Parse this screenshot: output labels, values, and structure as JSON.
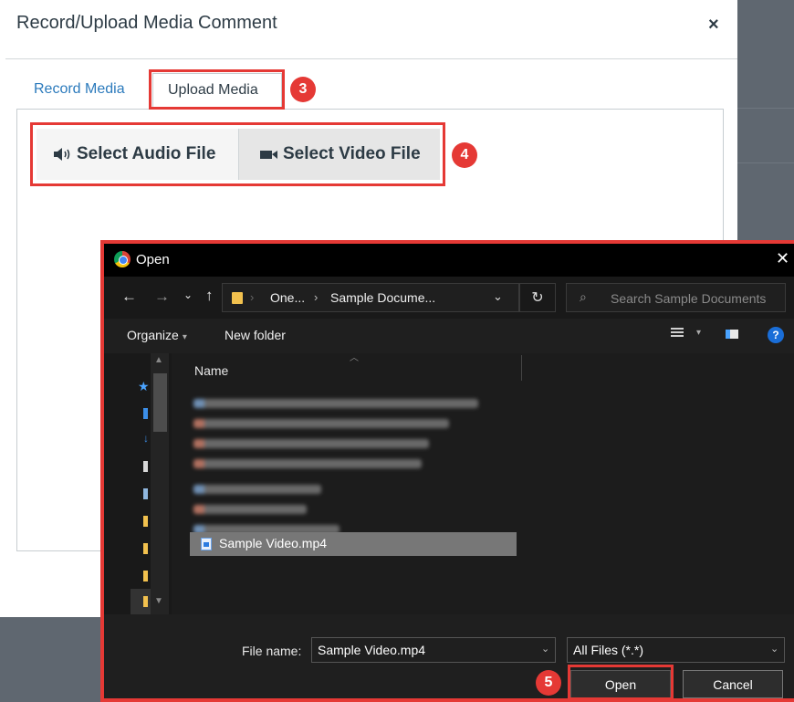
{
  "modal": {
    "title": "Record/Upload Media Comment",
    "close_glyph": "×",
    "tabs": [
      {
        "label": "Record Media",
        "active": false
      },
      {
        "label": "Upload Media",
        "active": true
      }
    ],
    "buttons": {
      "audio": {
        "label": "Select Audio File",
        "icon": "speaker-icon"
      },
      "video": {
        "label": "Select Video File",
        "icon": "video-camera-icon"
      }
    }
  },
  "annotations": {
    "step3": "3",
    "step4": "4",
    "step5": "5",
    "color": "#e53935"
  },
  "open_dialog": {
    "title": "Open",
    "close_glyph": "✕",
    "breadcrumb": [
      "One...",
      "Sample Docume..."
    ],
    "search_placeholder": "Search Sample Documents",
    "toolbar": {
      "organize": "Organize",
      "new_folder": "New folder"
    },
    "column_header": "Name",
    "selected_file": "Sample Video.mp4",
    "file_name_label": "File name:",
    "file_name_value": "Sample Video.mp4",
    "file_type_value": "All Files (*.*)",
    "open_label": "Open",
    "cancel_label": "Cancel"
  },
  "colors": {
    "link": "#2b7abc",
    "text": "#2d3b45",
    "dialog_bg": "#1f1f1f",
    "help_blue": "#1a6ed8"
  }
}
